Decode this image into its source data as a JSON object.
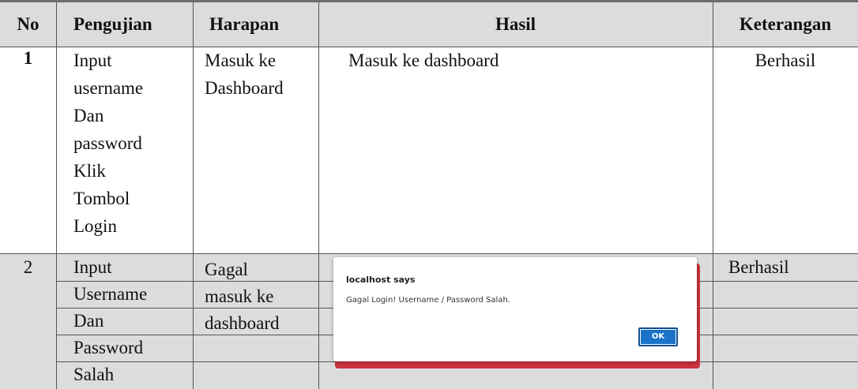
{
  "headers": {
    "no": "No",
    "pengujian": "Pengujian",
    "harapan": "Harapan",
    "hasil": "Hasil",
    "keterangan": "Keterangan"
  },
  "rows": [
    {
      "no": "1",
      "pengujian": [
        "Input",
        "username",
        "Dan",
        "password",
        "Klik",
        "Tombol",
        "Login"
      ],
      "harapan": [
        "Masuk ke",
        "Dashboard"
      ],
      "hasil": "Masuk ke dashboard",
      "keterangan": "Berhasil"
    },
    {
      "no": "2",
      "pengujian": [
        "Input",
        "Username",
        "Dan",
        "Password",
        "Salah"
      ],
      "harapan": [
        "Gagal",
        "masuk ke",
        "dashboard"
      ],
      "hasil": "",
      "keterangan": "Berhasil"
    }
  ],
  "dialog": {
    "title": "localhost says",
    "message": "Gagal Login! Username / Password Salah.",
    "ok_label": "OK",
    "accent_color": "#c9323e",
    "button_color": "#1a73c8"
  }
}
